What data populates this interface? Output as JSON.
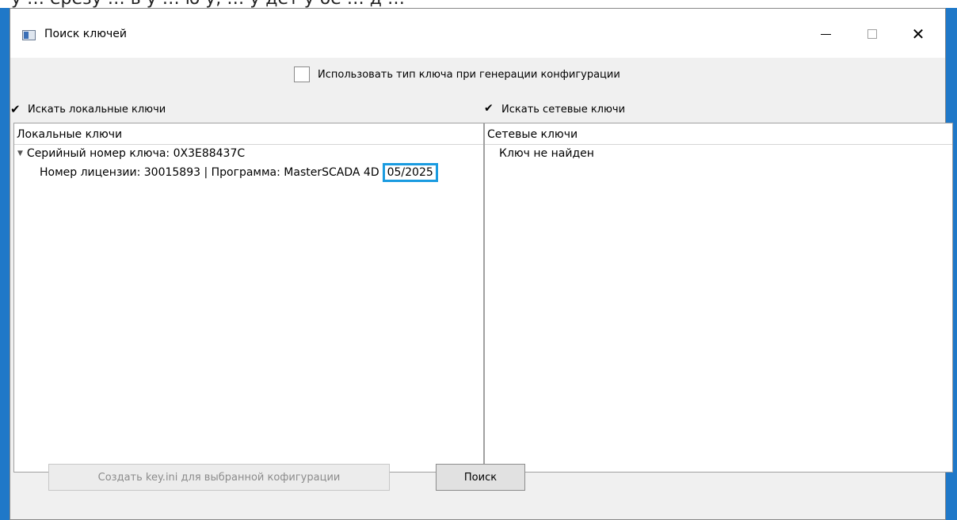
{
  "document": {
    "heading_fragment": "у     …     ерезу  …  ь  у  …  ю  у, … у дет у   ое … д  …"
  },
  "window": {
    "title": "Поиск ключей",
    "icon": "app-window-icon"
  },
  "options": {
    "use_key_type_label": "Использовать тип ключа при генерации конфигурации",
    "use_key_type_checked": false,
    "search_local_label": "Искать локальные ключи",
    "search_local_checked": true,
    "search_network_label": "Искать сетевые ключи",
    "search_network_checked": true
  },
  "local_panel": {
    "header": "Локальные ключи",
    "tree": [
      {
        "label": "Серийный номер ключа: 0X3E88437C",
        "expanded": true,
        "children": [
          {
            "label": "Номер лицензии: 30015893 | Программа: MasterSCADA 4D",
            "date": "05/2025"
          }
        ]
      }
    ]
  },
  "network_panel": {
    "header": "Сетевые ключи",
    "message": "Ключ не найден"
  },
  "buttons": {
    "create_label": "Создать key.ini для выбранной кофигурации",
    "create_enabled": false,
    "search_label": "Поиск"
  },
  "colors": {
    "highlight": "#1a9be0",
    "desktop_edge": "#1f78c8"
  }
}
